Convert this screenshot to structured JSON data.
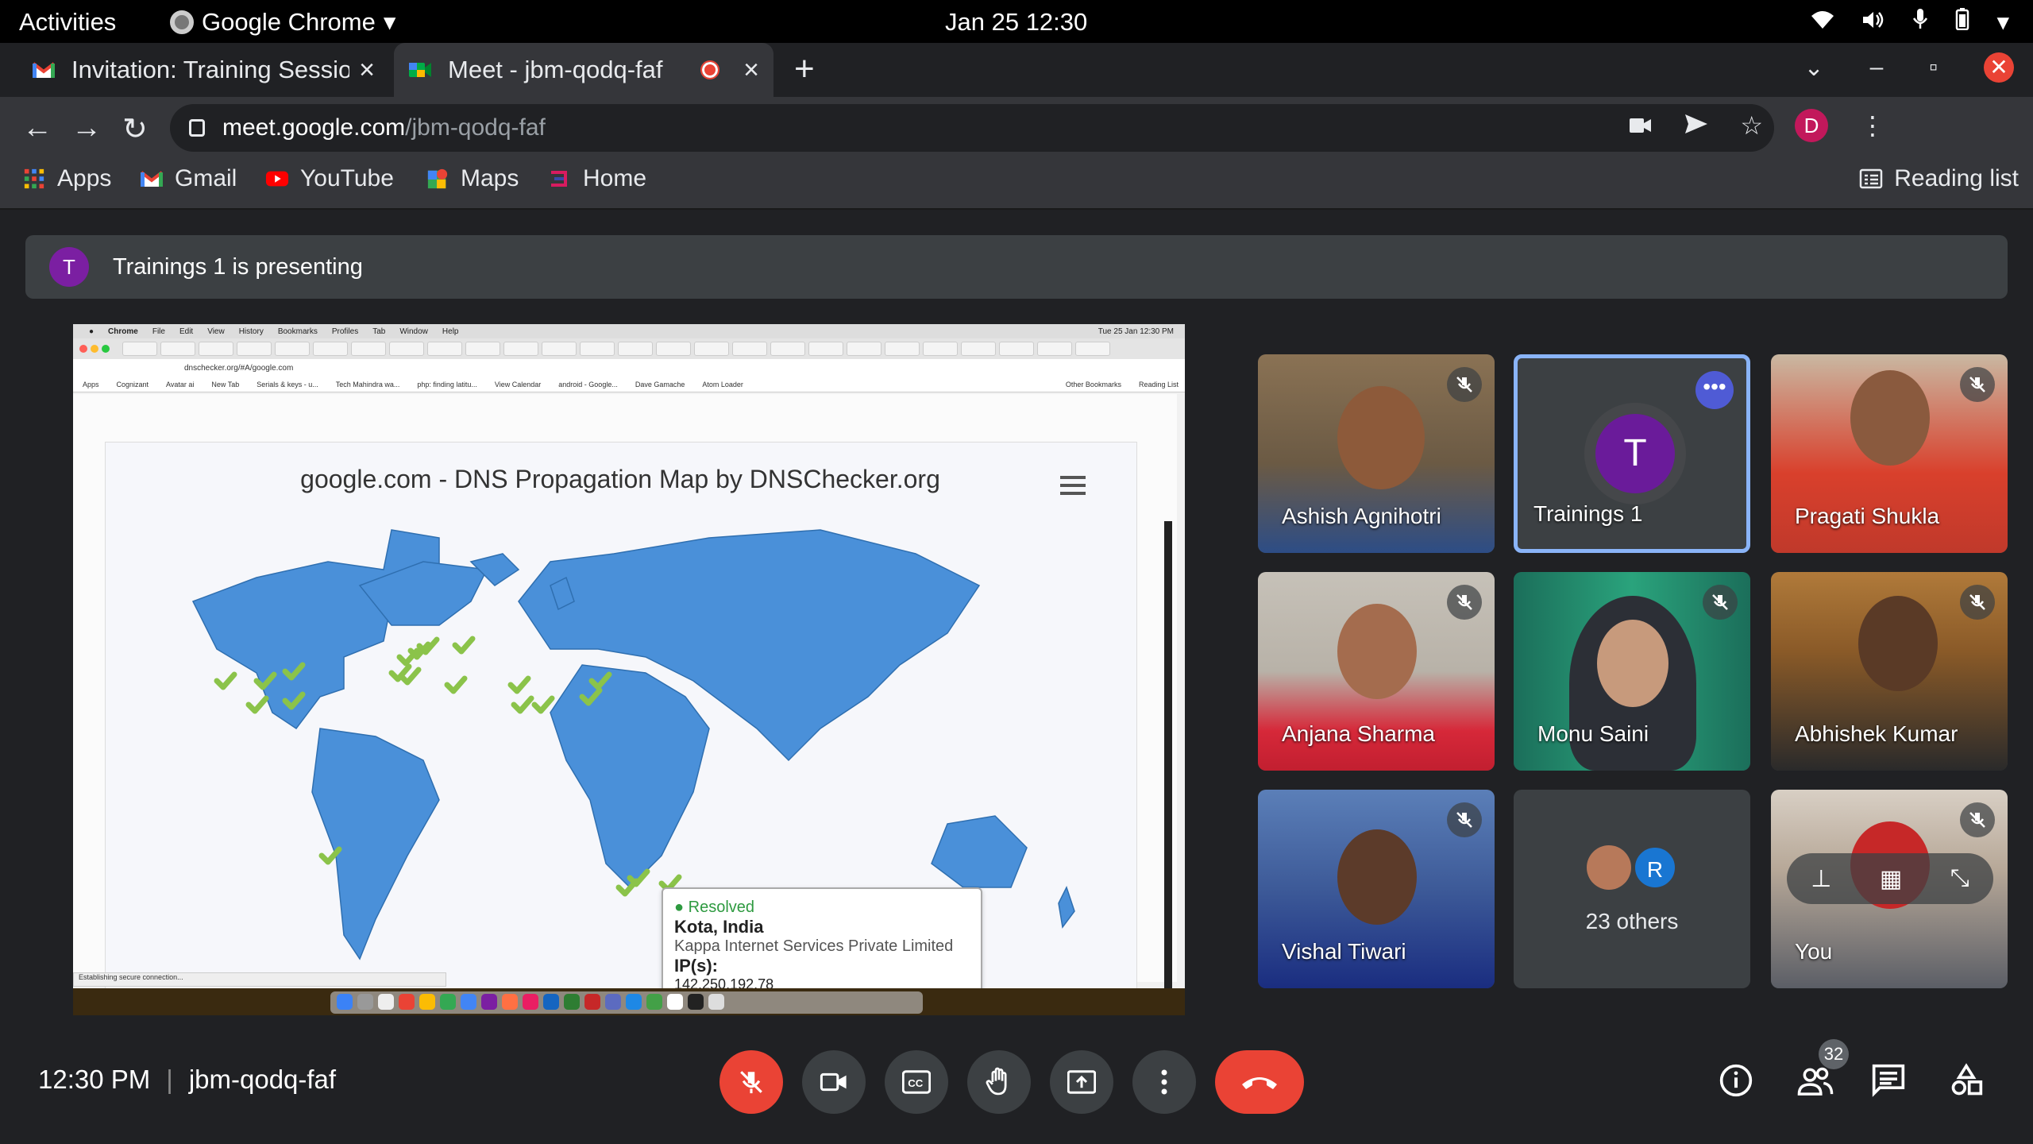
{
  "system": {
    "activities": "Activities",
    "app_name": "Google Chrome",
    "clock": "Jan 25  12:30"
  },
  "tabs": [
    {
      "label": "Invitation: Training Sessio"
    },
    {
      "label": "Meet - jbm-qodq-faf"
    }
  ],
  "omnibox": {
    "domain": "meet.google.com",
    "path": "/jbm-qodq-faf"
  },
  "profile_initial": "D",
  "bookmarks": [
    {
      "label": "Apps",
      "icon": "apps-grid-icon"
    },
    {
      "label": "Gmail",
      "icon": "gmail-icon"
    },
    {
      "label": "YouTube",
      "icon": "youtube-icon"
    },
    {
      "label": "Maps",
      "icon": "maps-icon"
    },
    {
      "label": "Home",
      "icon": "home-icon"
    }
  ],
  "reading_list": "Reading list",
  "presenting": {
    "initial": "T",
    "text": "Trainings 1 is presenting"
  },
  "shared_screen": {
    "mac_menu": [
      "Chrome",
      "File",
      "Edit",
      "View",
      "History",
      "Bookmarks",
      "Profiles",
      "Tab",
      "Window",
      "Help"
    ],
    "mac_clock": "Tue 25 Jan  12:30 PM",
    "url": "dnschecker.org/#A/google.com",
    "bookmarks": [
      "Apps",
      "Cognizant",
      "Avatar ai",
      "New Tab",
      "Serials & keys - u...",
      "Tech Mahindra wa...",
      "php: finding latitu...",
      "View Calendar",
      "android - Google...",
      "Dave Gamache",
      "Atom Loader",
      "Other Bookmarks",
      "Reading List"
    ],
    "map_title": "google.com - DNS Propagation Map by DNSChecker.org",
    "tooltip": {
      "status": "Resolved",
      "location": "Kota, India",
      "provider": "Kappa Internet Services Private Limited",
      "ip_label": "IP(s):",
      "ip": "142.250.192.78"
    },
    "status_bar": "Establishing secure connection..."
  },
  "participants": [
    {
      "name": "Ashish Agnihotri",
      "muted": true
    },
    {
      "name": "Trainings 1",
      "initial": "T",
      "presenting": true
    },
    {
      "name": "Pragati Shukla",
      "muted": true
    },
    {
      "name": "Anjana Sharma",
      "muted": true
    },
    {
      "name": "Monu Saini",
      "muted": true
    },
    {
      "name": "Abhishek Kumar",
      "muted": true
    },
    {
      "name": "Vishal Tiwari",
      "muted": true
    },
    {
      "name": "23 others",
      "initial": "R"
    },
    {
      "name": "You",
      "muted": true
    }
  ],
  "meeting": {
    "time": "12:30 PM",
    "separator": "|",
    "code": "jbm-qodq-faf",
    "people_count": "32"
  },
  "colors": {
    "accent": "#8ab4f8",
    "danger": "#ea4335",
    "map_land": "#4a90d9",
    "check": "#8bc34a"
  }
}
